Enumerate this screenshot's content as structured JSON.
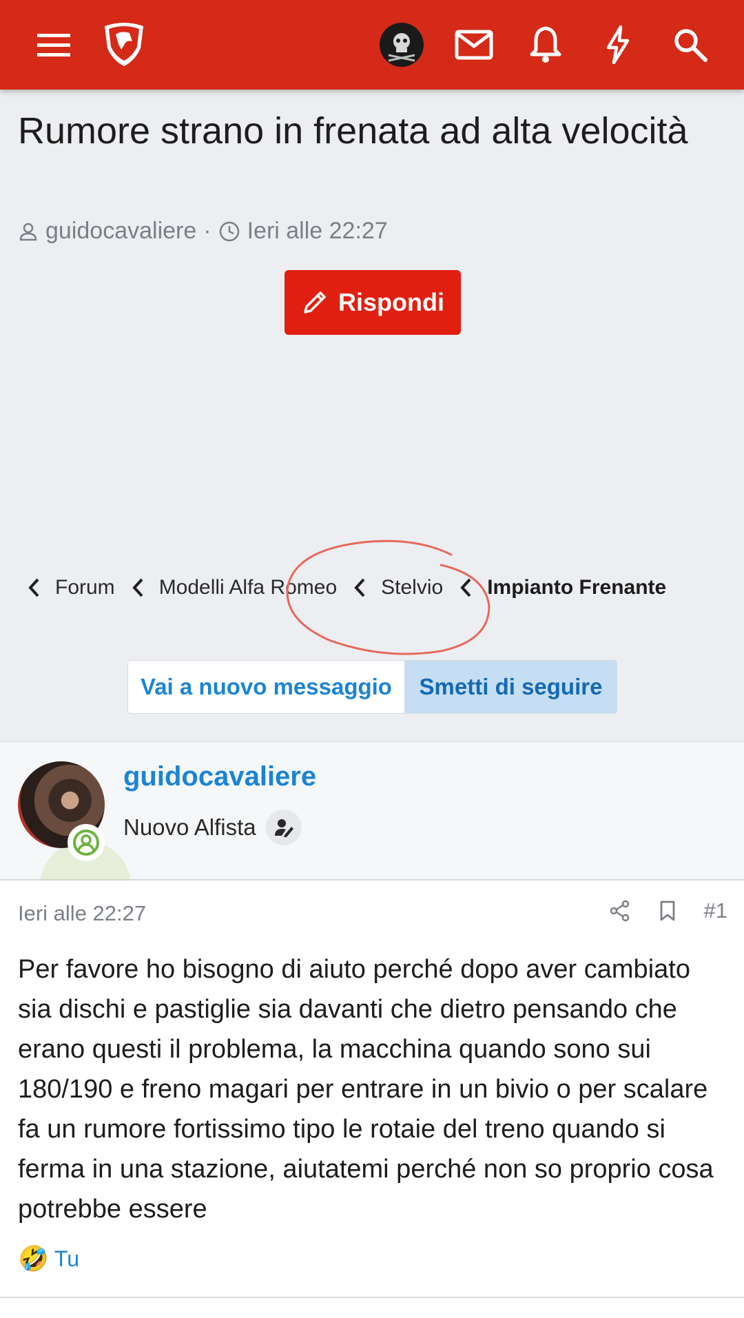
{
  "header": {
    "menu_icon": "menu-icon",
    "logo_icon": "site-logo-shield",
    "icons": [
      "avatar-pirate",
      "mail-icon",
      "bell-icon",
      "bolt-icon",
      "search-icon"
    ],
    "accent_color": "#d42a17"
  },
  "thread": {
    "title": "Rumore strano in frenata ad alta velocità",
    "author": "guidocavaliere",
    "separator": "·",
    "date": "Ieri alle 22:27",
    "reply_label": "Rispondi"
  },
  "breadcrumb": {
    "items": [
      "Forum",
      "Modelli Alfa Romeo",
      "Stelvio",
      "Impianto Frenante"
    ]
  },
  "actions": {
    "new_message_label": "Vai a nuovo messaggio",
    "unfollow_label": "Smetti di seguire"
  },
  "post": {
    "username": "guidocavaliere",
    "user_title": "Nuovo Alfista",
    "date": "Ieri alle 22:27",
    "post_number": "#1",
    "text": "Per favore ho bisogno di aiuto perché dopo aver cambiato sia dischi e pastiglie sia davanti che dietro pensando che erano questi il problema, la macchina quando sono sui 180/190 e freno magari per entrare in un bivio o per scalare fa un rumore fortissimo tipo le rotaie del treno quando si ferma in una stazione, aiutatemi perché non so proprio cosa potrebbe essere",
    "reaction_emoji": "🤣",
    "reaction_label": "Tu"
  }
}
